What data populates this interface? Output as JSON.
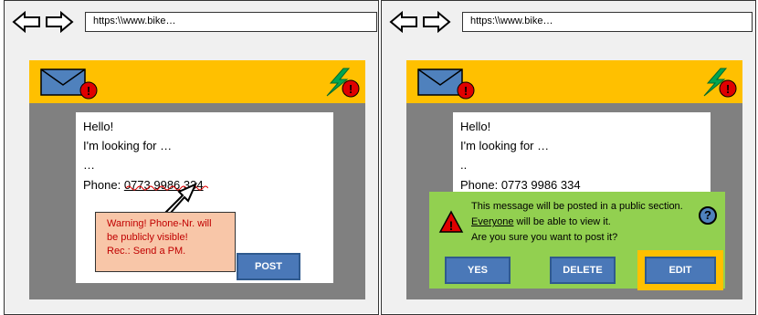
{
  "browser": {
    "url": "https:\\\\www.bike…"
  },
  "message": {
    "line1": "Hello!",
    "line2": "I'm looking for …",
    "line3_left": "…",
    "line3_right": "..",
    "phone_label": "Phone: ",
    "phone_number": "0773 9986 334"
  },
  "left": {
    "post_label": "POST",
    "warning": {
      "line1": "Warning! Phone-Nr. will",
      "line2": "be publicly visible!",
      "line3": "Rec.: Send a PM."
    }
  },
  "right": {
    "dialog": {
      "line1": "This message will be posted in a public section.",
      "line2_underlined": "Everyone",
      "line2_rest": " will be able to view it.",
      "line3": "Are you sure you want to post it?",
      "help_symbol": "?"
    },
    "buttons": {
      "yes": "YES",
      "delete": "DELETE",
      "edit": "EDIT"
    }
  },
  "colors": {
    "header_yellow": "#ffc000",
    "content_gray": "#808080",
    "button_blue": "#4a78b8",
    "dialog_green": "#92d050",
    "warning_peach": "#f8c6a8",
    "warning_text": "#c00000",
    "badge_red": "#e00000"
  },
  "icons": [
    "back-arrow-icon",
    "forward-arrow-icon",
    "envelope-icon",
    "notification-badge-icon",
    "lightning-icon",
    "warning-triangle-icon",
    "help-icon"
  ]
}
